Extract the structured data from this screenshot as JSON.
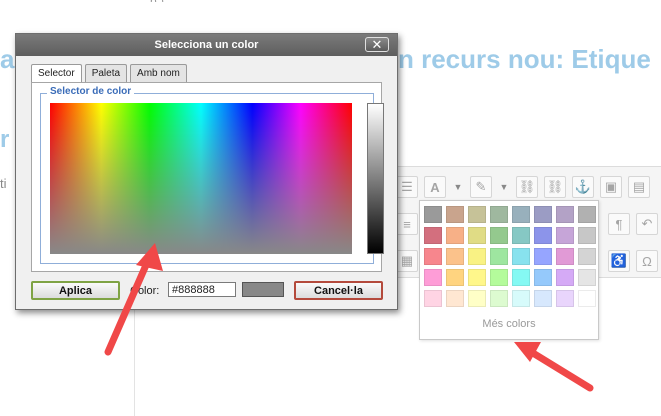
{
  "background": {
    "heading_fragment_left": "a",
    "heading_fragment_right": "n recurs nou: Etique",
    "side_fragment_large": "r",
    "side_fragment_small": "ti",
    "top_fragment": "p     )",
    "heading_color": "#9ecbe8"
  },
  "toolbar": {
    "row1_icons": [
      "list-icon",
      "font-color-icon",
      "highlight-icon",
      "link-icon",
      "unlink-icon",
      "anchor-icon",
      "image-icon",
      "media-icon"
    ],
    "row2_icons": [
      "paragraph-icon",
      "undo-icon"
    ],
    "row3_icons": [
      "table-icon",
      "accessibility-icon"
    ]
  },
  "swatch_panel": {
    "colors": [
      "#9a9a9a",
      "#c9a48d",
      "#c6c298",
      "#9fb89f",
      "#98b0bc",
      "#9b9cc4",
      "#b3a2c6",
      "#b1b1b1",
      "#d36f7e",
      "#f7b087",
      "#e0dc85",
      "#94c98e",
      "#86c8c4",
      "#8c94ea",
      "#c6a5d8",
      "#c7c7c7",
      "#f7868d",
      "#fbc28b",
      "#f9f284",
      "#9ee6a0",
      "#88e2ee",
      "#96a5ff",
      "#e19ad6",
      "#d4d4d4",
      "#fe9dd7",
      "#ffd480",
      "#fff78b",
      "#b4fb9b",
      "#85f9f3",
      "#95c9fb",
      "#d5aaf6",
      "#e5e5e5",
      "#ffd4e4",
      "#ffe7d2",
      "#ffffc7",
      "#ddfbd0",
      "#d7fbfb",
      "#d7e8fd",
      "#e9d5fc",
      "#ffffff"
    ],
    "more_colors_label": "Més colors"
  },
  "dialog": {
    "title": "Selecciona un color",
    "close_symbol": "✕",
    "tabs": [
      {
        "label": "Selector",
        "active": true
      },
      {
        "label": "Paleta",
        "active": false
      },
      {
        "label": "Amb nom",
        "active": false
      }
    ],
    "fieldset_legend": "Selector de color",
    "apply_label": "Aplica",
    "color_label": "Color:",
    "color_value": "#888888",
    "preview_color": "#888888",
    "cancel_label": "Cancel·la"
  },
  "annotation_color": "#f04848"
}
